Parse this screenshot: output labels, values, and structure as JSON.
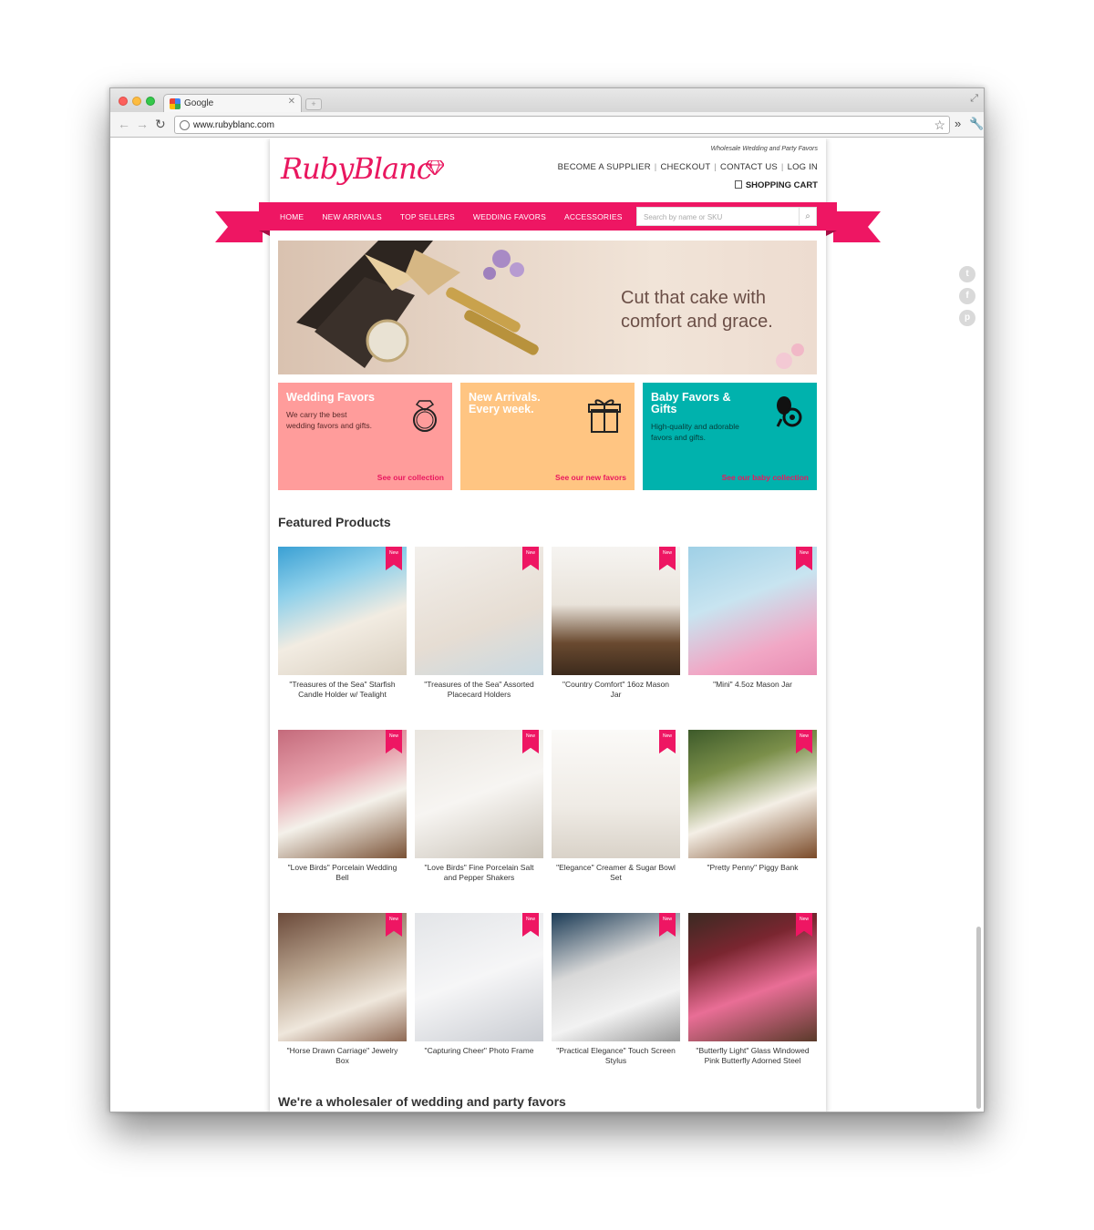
{
  "browser": {
    "tab_title": "Google",
    "url": "www.rubyblanc.com"
  },
  "site": {
    "logo": "RubyBlanc",
    "tagline": "Wholesale Wedding and Party Favors",
    "top_links": [
      "BECOME A SUPPLIER",
      "CHECKOUT",
      "CONTACT US",
      "LOG IN"
    ],
    "cart_label": "SHOPPING CART",
    "brand_color": "#ee1663"
  },
  "nav": {
    "links": [
      "HOME",
      "NEW ARRIVALS",
      "TOP SELLERS",
      "WEDDING FAVORS",
      "ACCESSORIES"
    ],
    "search_placeholder": "Search by name or SKU"
  },
  "hero": {
    "line1": "Cut that cake with",
    "line2": "comfort and grace."
  },
  "promos": [
    {
      "title": "Wedding Favors",
      "text_line1": "We carry the best",
      "text_line2": "wedding favors and gifts.",
      "link": "See our collection",
      "color": "#ff9c9b",
      "icon": "ring-icon"
    },
    {
      "title_line1": "New Arrivals.",
      "title_line2": "Every week.",
      "link": "See our new favors",
      "color": "#ffc582",
      "icon": "gift-icon"
    },
    {
      "title_line1": "Baby Favors &",
      "title_line2": "Gifts",
      "text_line1": "High-quality and adorable",
      "text_line2": "favors and gifts.",
      "link": "See our baby collection",
      "color": "#00b2ad",
      "icon": "pacifier-icon"
    }
  ],
  "featured": {
    "title": "Featured Products",
    "badge": "New",
    "products": [
      {
        "line1": "\"Treasures of the Sea\" Starfish",
        "line2": "Candle Holder w/ Tealight"
      },
      {
        "line1": "\"Treasures of the Sea\" Assorted",
        "line2": "Placecard Holders"
      },
      {
        "line1": "\"Country Comfort\" 16oz Mason",
        "line2": "Jar"
      },
      {
        "line1": "\"Mini\" 4.5oz Mason Jar",
        "line2": ""
      },
      {
        "line1": "\"Love Birds\" Porcelain Wedding",
        "line2": "Bell"
      },
      {
        "line1": "\"Love Birds\" Fine Porcelain Salt",
        "line2": "and Pepper Shakers"
      },
      {
        "line1": "\"Elegance\" Creamer & Sugar Bowl",
        "line2": "Set"
      },
      {
        "line1": "\"Pretty Penny\" Piggy Bank",
        "line2": ""
      },
      {
        "line1": "\"Horse Drawn Carriage\" Jewelry",
        "line2": "Box"
      },
      {
        "line1": "\"Capturing Cheer\" Photo Frame",
        "line2": ""
      },
      {
        "line1": "\"Practical Elegance\" Touch Screen",
        "line2": "Stylus"
      },
      {
        "line1": "\"Butterfly Light\" Glass Windowed",
        "line2": "Pink Butterfly Adorned Steel"
      }
    ]
  },
  "about": {
    "title": "We're a wholesaler of wedding and party favors"
  }
}
